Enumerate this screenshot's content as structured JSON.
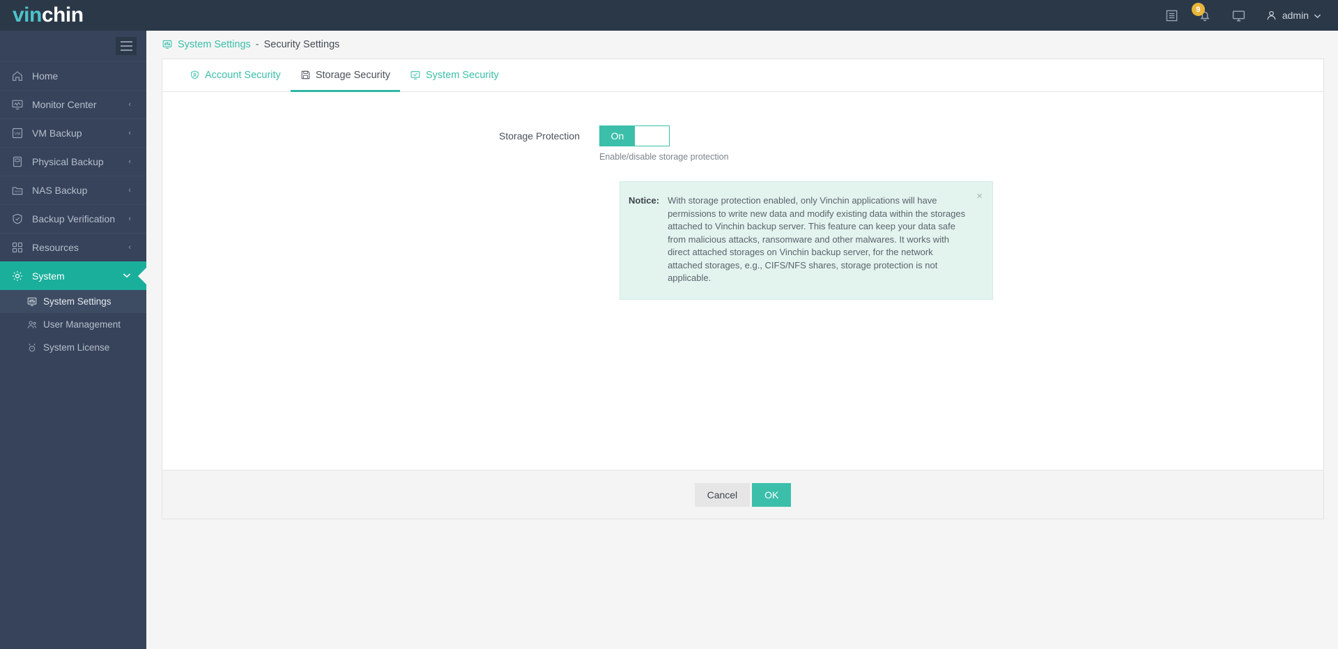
{
  "header": {
    "logo_primary": "vin",
    "logo_secondary": "chin",
    "icons": [
      {
        "name": "log-list-icon",
        "label": "Logs"
      },
      {
        "name": "bell-icon",
        "label": "Alerts",
        "badge": "9"
      },
      {
        "name": "monitor-icon",
        "label": "Console"
      }
    ],
    "user": "admin",
    "user_caret": "⌄",
    "badge_color": "#e9b63a"
  },
  "sidebar": {
    "collapse_icon": "hamburger-icon",
    "items": [
      {
        "label": "Home",
        "icon": "home-icon",
        "caret": "",
        "active": false
      },
      {
        "label": "Monitor Center",
        "icon": "monitor-chart-icon",
        "caret": "‹",
        "active": false
      },
      {
        "label": "VM Backup",
        "icon": "vm-icon",
        "caret": "‹",
        "active": false
      },
      {
        "label": "Physical Backup",
        "icon": "server-icon",
        "caret": "‹",
        "active": false
      },
      {
        "label": "NAS Backup",
        "icon": "nas-icon",
        "caret": "‹",
        "active": false
      },
      {
        "label": "Backup Verification",
        "icon": "shield-check-icon",
        "caret": "‹",
        "active": false
      },
      {
        "label": "Resources",
        "icon": "grid-icon",
        "caret": "‹",
        "active": false
      },
      {
        "label": "System",
        "icon": "gear-icon",
        "caret": "∨",
        "active": true
      }
    ],
    "subitems": [
      {
        "label": "System Settings",
        "icon": "sliders-monitor-icon",
        "selected": true
      },
      {
        "label": "User Management",
        "icon": "users-icon",
        "selected": false
      },
      {
        "label": "System License",
        "icon": "license-icon",
        "selected": false
      }
    ],
    "accent_color": "#1aaf9b",
    "background": "#36435a"
  },
  "breadcrumb": {
    "icon": "sliders-monitor-icon",
    "parent": "System Settings",
    "separator": "-",
    "current": "Security Settings"
  },
  "tabs": [
    {
      "label": "Account Security",
      "icon": "user-shield-icon",
      "active": false
    },
    {
      "label": "Storage Security",
      "icon": "floppy-disk-icon",
      "active": true
    },
    {
      "label": "System Security",
      "icon": "monitor-check-icon",
      "active": false
    }
  ],
  "form": {
    "field_label": "Storage Protection",
    "toggle_state": "On",
    "toggle_help": "Enable/disable storage protection"
  },
  "notice": {
    "label": "Notice:",
    "text": "With storage protection enabled, only Vinchin applications will have permissions to write new data and modify existing data within the storages attached to Vinchin backup server. This feature can keep your data safe from malicious attacks, ransomware and other malwares. It works with direct attached storages on Vinchin backup server, for the network attached storages, e.g., CIFS/NFS shares, storage protection is not applicable.",
    "close_icon": "close-icon",
    "close_glyph": "×",
    "background": "#e3f4ef"
  },
  "footer": {
    "cancel_label": "Cancel",
    "ok_label": "OK",
    "ok_color": "#3bbfaa"
  }
}
